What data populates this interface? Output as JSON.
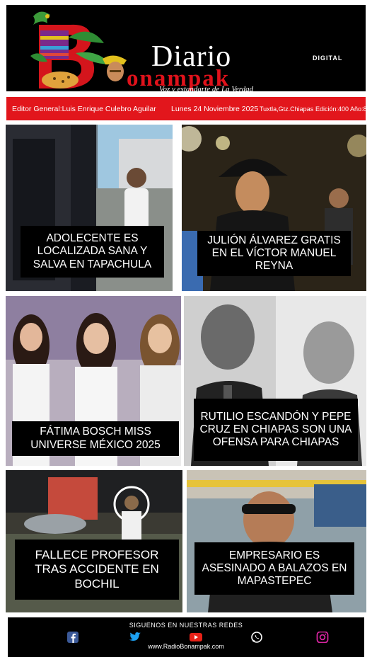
{
  "masthead": {
    "brand_top": "Diario",
    "brand_digital": "DIGITAL",
    "brand_bottom": "onampak",
    "tagline": "Voz y estandarte de La Verdad"
  },
  "info_bar": {
    "editor": "Editor General:Luis Enrique Culebro Aguilar",
    "date": "Lunes 24 Noviembre 2025",
    "location": "Tuxtla,Gtz.Chiapas",
    "edition": "Edición:400 Año:8"
  },
  "news": [
    {
      "headline": "ADOLECENTE ES LOCALIZADA SANA Y SALVA EN TAPACHULA"
    },
    {
      "headline": "JULIÓN ÁLVAREZ GRATIS EN EL VÍCTOR MANUEL REYNA"
    },
    {
      "headline": "FÁTIMA BOSCH MISS UNIVERSE MÉXICO 2025"
    },
    {
      "headline": "RUTILIO ESCANDÓN Y PEPE CRUZ EN CHIAPAS SON UNA OFENSA PARA CHIAPAS"
    },
    {
      "headline": "FALLECE PROFESOR TRAS ACCIDENTE EN BOCHIL"
    },
    {
      "headline": "EMPRESARIO ES ASESINADO A BALAZOS EN MAPASTEPEC"
    }
  ],
  "footer": {
    "follow_text": "SIGUENOS EN NUESTRAS REDES",
    "website": "www.RadioBonampak.com",
    "social_icons": [
      "facebook-icon",
      "twitter-icon",
      "youtube-icon",
      "whatsapp-icon",
      "instagram-icon"
    ]
  },
  "colors": {
    "brand_red": "#e2161c",
    "masthead_bg": "#000000",
    "headline_bg": "#000000"
  }
}
